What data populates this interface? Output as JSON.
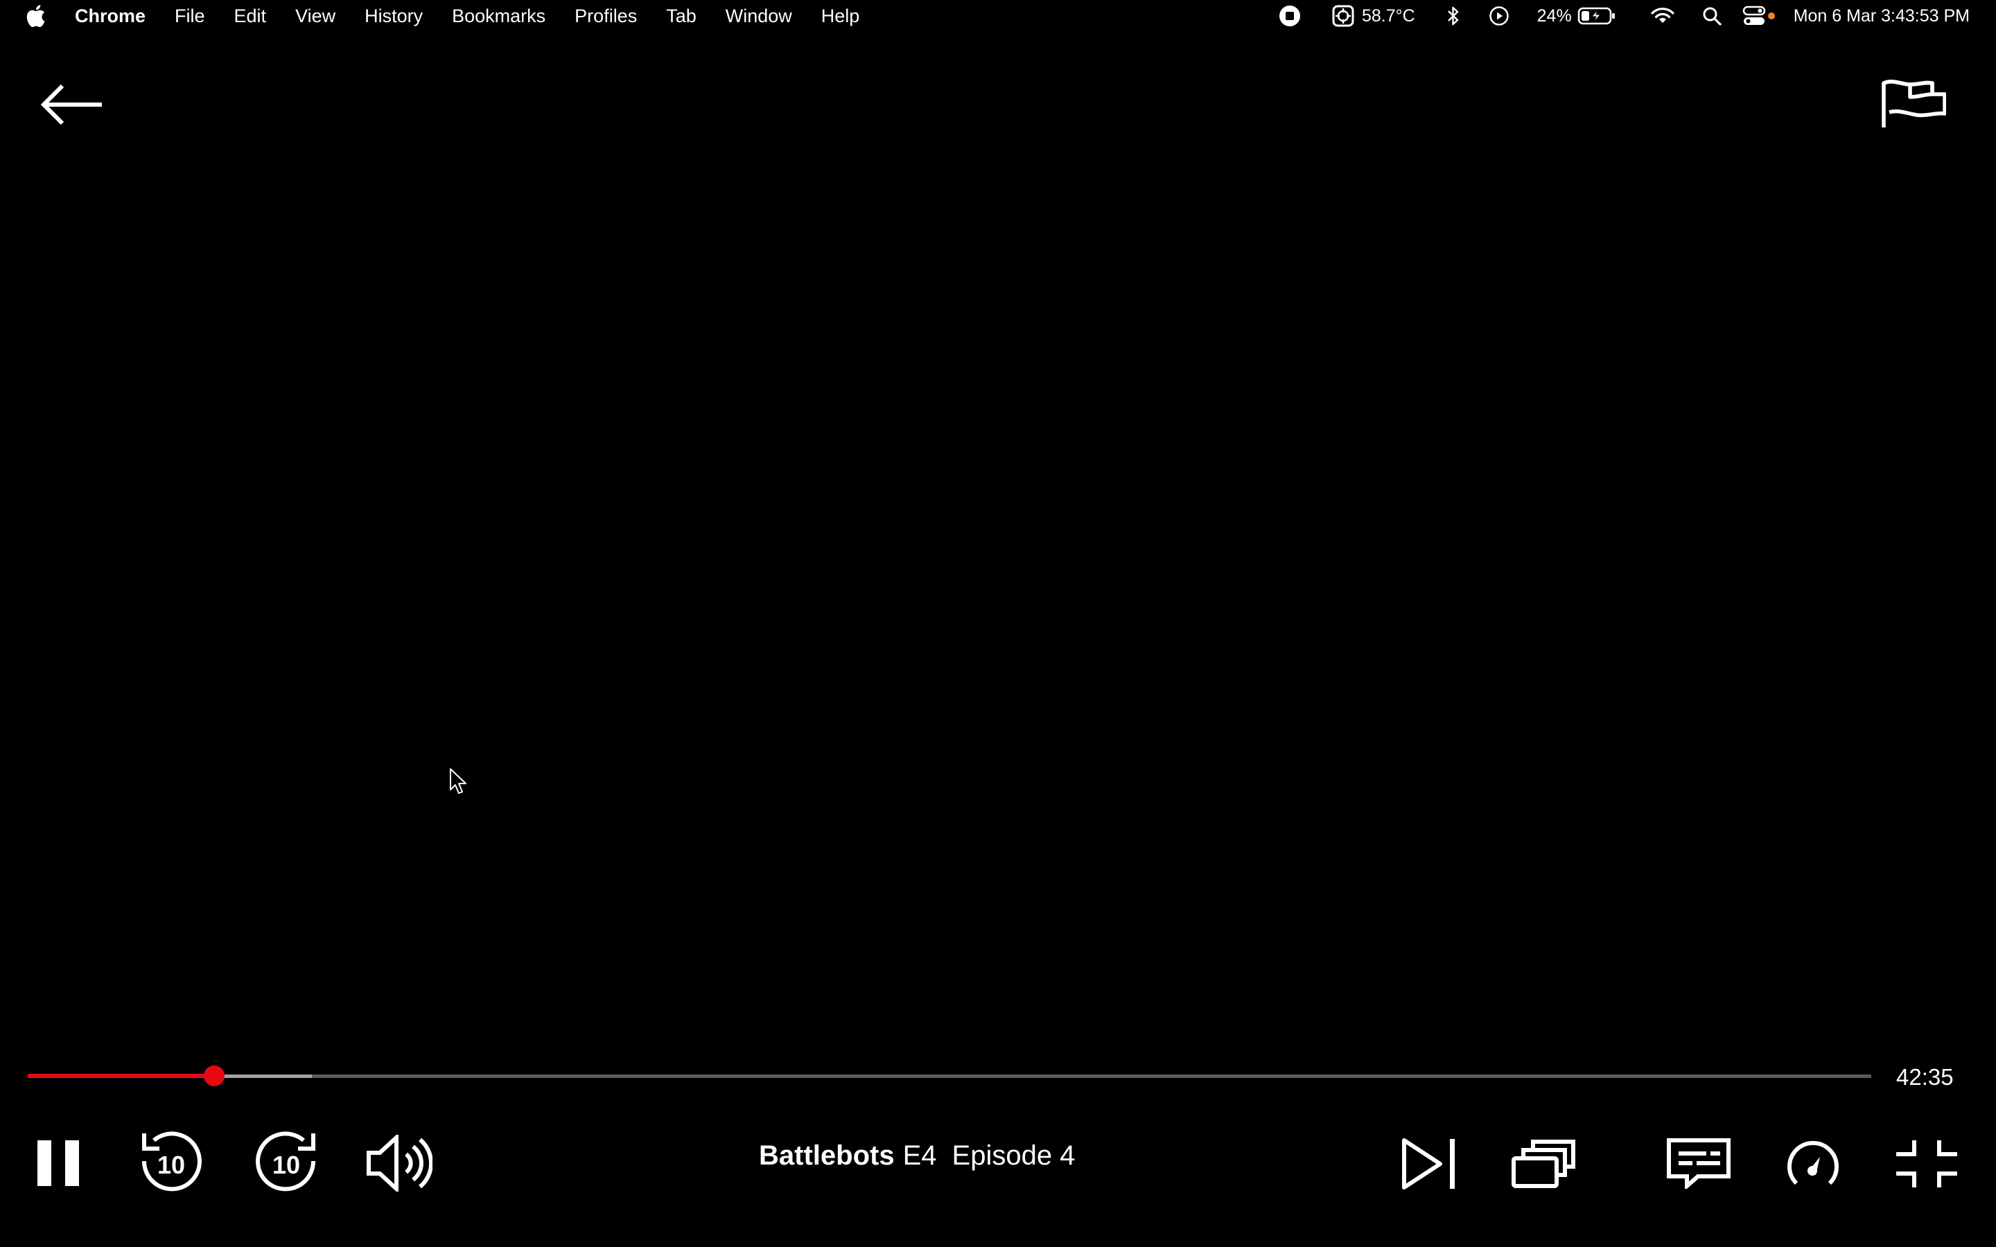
{
  "menubar": {
    "app_name": "Chrome",
    "items": [
      "File",
      "Edit",
      "View",
      "History",
      "Bookmarks",
      "Profiles",
      "Tab",
      "Window",
      "Help"
    ],
    "temperature": "58.7°C",
    "battery_percent": "24%",
    "datetime": "Mon 6 Mar  3:43:53 PM",
    "icons": [
      "apple-logo",
      "screen-record-icon",
      "cpu-temp-icon",
      "bluetooth-icon",
      "play-circle-icon",
      "battery-charging-icon",
      "wifi-icon",
      "spotlight-search-icon",
      "control-center-icon"
    ]
  },
  "player": {
    "back_icon": "arrow-left-icon",
    "report_icon": "flag-icon",
    "progress": {
      "played_fraction": 0.101,
      "buffered_fraction": 0.154
    },
    "time_remaining": "42:35",
    "title": {
      "show": "Battlebots",
      "episode_code": "E4",
      "episode_name": "Episode 4"
    },
    "controls_left": [
      "pause-icon",
      "rewind-10-icon",
      "forward-10-icon",
      "volume-icon"
    ],
    "controls_right": [
      "next-episode-icon",
      "episodes-icon",
      "subtitles-icon",
      "playback-speed-icon",
      "exit-fullscreen-icon"
    ],
    "rewind_seconds": "10",
    "forward_seconds": "10",
    "accent_color": "#e50914"
  }
}
